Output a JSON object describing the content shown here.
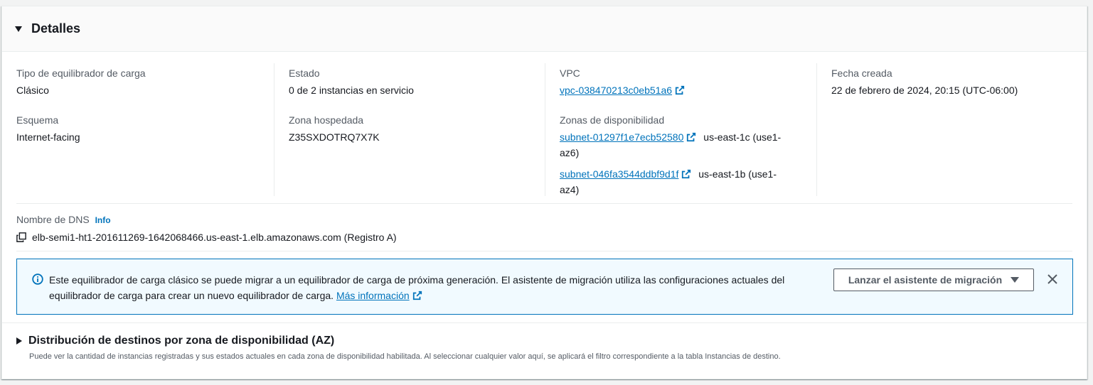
{
  "details": {
    "title": "Detalles",
    "fields": {
      "tipo_label": "Tipo de equilibrador de carga",
      "tipo_value": "Clásico",
      "esquema_label": "Esquema",
      "esquema_value": "Internet-facing",
      "estado_label": "Estado",
      "estado_value": "0 de 2 instancias en servicio",
      "zona_label": "Zona hospedada",
      "zona_value": "Z35SXDOTRQ7X7K",
      "vpc_label": "VPC",
      "vpc_value": "vpc-038470213c0eb51a6",
      "azs_label": "Zonas de disponibilidad",
      "azs": [
        {
          "subnet": "subnet-01297f1e7ecb52580",
          "az_line1": "us-east-1c (use1-",
          "az_line2": "az6)"
        },
        {
          "subnet": "subnet-046fa3544ddbf9d1f",
          "az_line1": "us-east-1b (use1-",
          "az_line2": "az4)"
        }
      ],
      "fecha_label": "Fecha creada",
      "fecha_value": "22 de febrero de 2024, 20:15 (UTC-06:00)"
    },
    "dns": {
      "label": "Nombre de DNS",
      "info": "Info",
      "value": "elb-semi1-ht1-201611269-1642068466.us-east-1.elb.amazonaws.com (Registro A)"
    }
  },
  "alert": {
    "text": "Este equilibrador de carga clásico se puede migrar a un equilibrador de carga de próxima generación. El asistente de migración utiliza las configuraciones actuales del equilibrador de carga para crear un nuevo equilibrador de carga.",
    "link": "Más información",
    "button": "Lanzar el asistente de migración"
  },
  "distribution": {
    "title": "Distribución de destinos por zona de disponibilidad (AZ)",
    "description": "Puede ver la cantidad de instancias registradas y sus estados actuales en cada zona de disponibilidad habilitada. Al seleccionar cualquier valor aquí, se aplicará el filtro correspondiente a la tabla Instancias de destino."
  },
  "colors": {
    "link": "#0073bb",
    "label": "#545b64",
    "alert_bg": "#f1faff",
    "alert_border": "#0073bb"
  }
}
